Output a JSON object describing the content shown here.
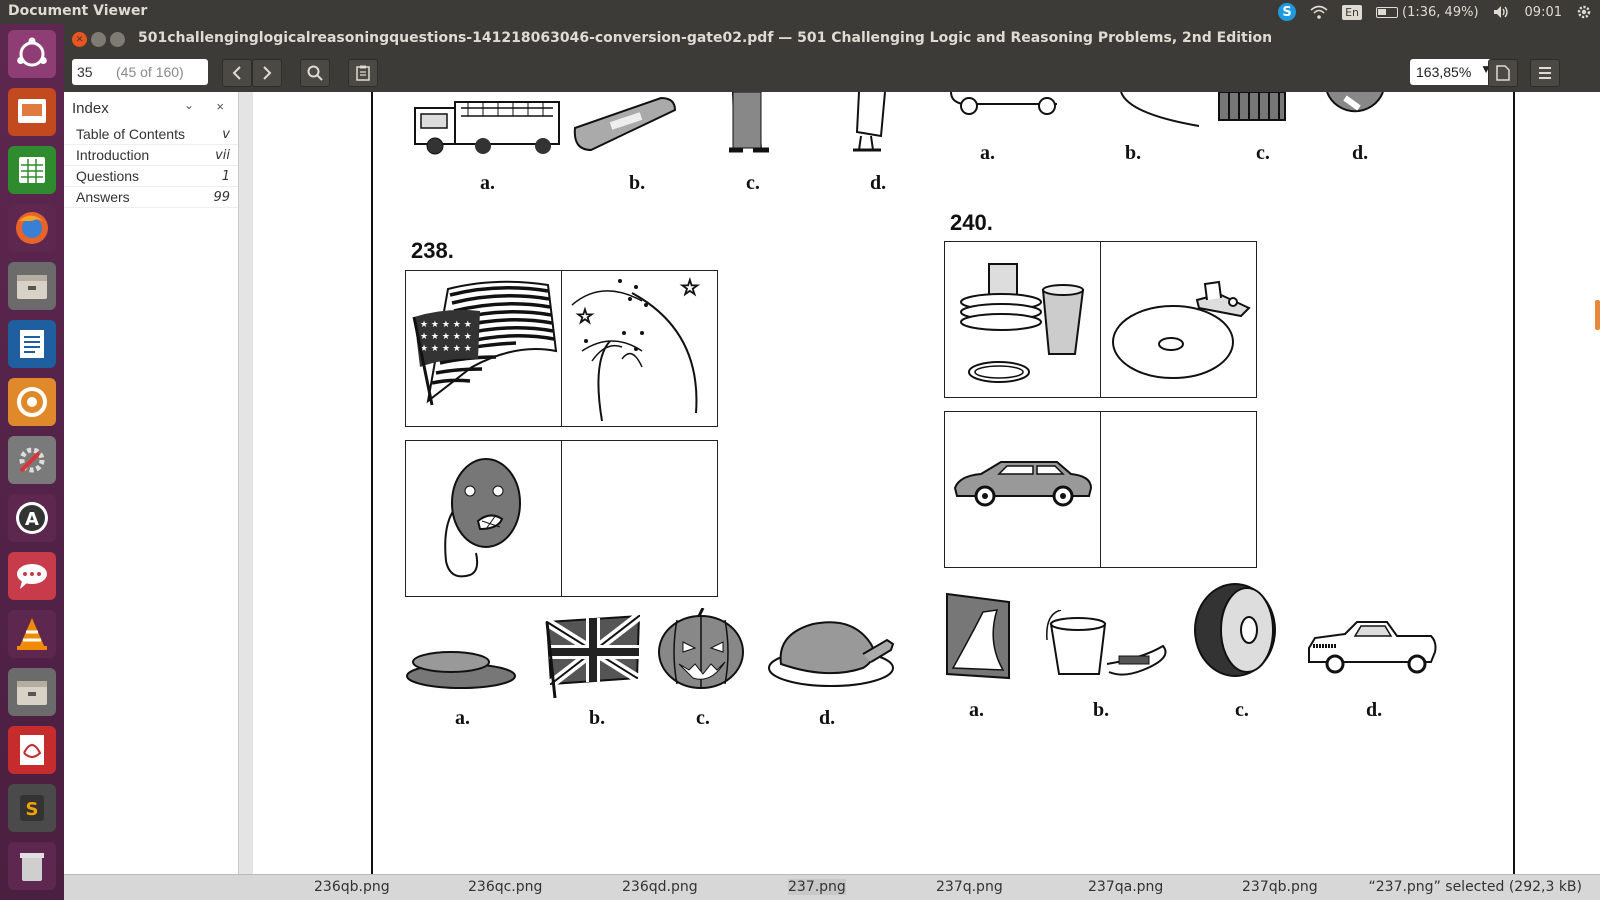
{
  "top_panel": {
    "app_title": "Document Viewer",
    "skype_icon": "S",
    "language": "En",
    "battery": "(1:36, 49%)",
    "time": "09:01"
  },
  "launcher": {
    "items": [
      "ubuntu-logo-icon",
      "impress-icon",
      "calc-icon",
      "firefox-icon",
      "files-icon",
      "writer-icon",
      "shotwell-icon",
      "system-settings-icon",
      "software-updater-icon",
      "chat-icon",
      "vlc-icon",
      "files-icon",
      "document-viewer-icon",
      "sublime-text-icon",
      "trash-icon"
    ]
  },
  "window": {
    "title": "501challenginglogicalreasoningquestions-141218063046-conversion-gate02.pdf — 501 Challenging Logic and Reasoning Problems, 2nd Edition"
  },
  "toolbar": {
    "page_value": "35",
    "page_of": "(45 of 160)",
    "zoom": "163,85%"
  },
  "sidebar": {
    "title": "Index",
    "close": "×",
    "items": [
      {
        "label": "Table of Contents",
        "page": "v"
      },
      {
        "label": "Introduction",
        "page": "vii"
      },
      {
        "label": "Questions",
        "page": "1"
      },
      {
        "label": "Answers",
        "page": "99"
      }
    ]
  },
  "document": {
    "top_left_choices": [
      "a.",
      "b.",
      "c.",
      "d."
    ],
    "top_right_choices": [
      "a.",
      "b.",
      "c.",
      "d."
    ],
    "q238": {
      "number": "238.",
      "choices": [
        "a.",
        "b.",
        "c.",
        "d."
      ]
    },
    "q240": {
      "number": "240.",
      "choices": [
        "a.",
        "b.",
        "c.",
        "d."
      ]
    }
  },
  "bottom_strip": {
    "files": [
      "236qb.png",
      "236qc.png",
      "236qd.png",
      "237.png",
      "237q.png",
      "237qa.png",
      "237qb.png"
    ],
    "status": "“237.png” selected  (292,3 kB)"
  },
  "colors": {
    "panel": "#3c3b37",
    "launcher": "#5e2750",
    "accent": "#e8883a"
  }
}
